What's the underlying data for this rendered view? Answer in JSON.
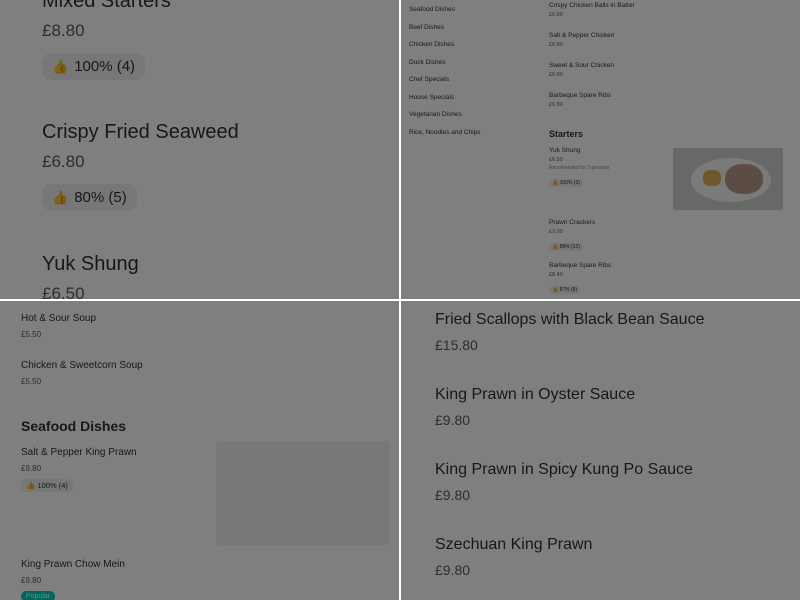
{
  "top_left": {
    "items": [
      {
        "name": "Mixed Starters",
        "price": "£8.80",
        "rating": "100% (4)"
      },
      {
        "name": "Crispy Fried Seaweed",
        "price": "£6.80",
        "rating": "80% (5)"
      },
      {
        "name": "Yuk Shung",
        "price": "£6.50"
      }
    ]
  },
  "top_right": {
    "nav": [
      "Seafood Dishes",
      "Beef Dishes",
      "Chicken Dishes",
      "Duck Dishes",
      "Chef Specials",
      "House Specials",
      "Vegetarian Dishes",
      "Rice, Noodles and Chips"
    ],
    "top_items": [
      {
        "name": "Crispy Chicken Balls in Batter",
        "price": "£6.80"
      },
      {
        "name": "Salt & Pepper Chicken",
        "price": "£6.80"
      },
      {
        "name": "Sweet & Sour Chicken",
        "price": "£6.80"
      },
      {
        "name": "Barbeque Spare Ribs",
        "price": "£6.80"
      }
    ],
    "starters_heading": "Starters",
    "starters": [
      {
        "name": "Yuk Shung",
        "price": "£6.50",
        "desc": "Recomended for 2 persons",
        "rating": "100% (3)"
      },
      {
        "name": "Prawn Crackers",
        "price": "£3.00",
        "rating": "88% (12)"
      },
      {
        "name": "Barbeque Spare Ribs",
        "price": "£8.40",
        "rating": "87% (8)"
      }
    ]
  },
  "bottom_left": {
    "soups": [
      {
        "name": "Hot & Sour Soup",
        "price": "£5.50"
      },
      {
        "name": "Chicken & Sweetcorn Soup",
        "price": "£5.50"
      }
    ],
    "seafood_heading": "Seafood Dishes",
    "seafood": [
      {
        "name": "Salt & Pepper King Prawn",
        "price": "£9.80",
        "rating": "100% (4)"
      },
      {
        "name": "King Prawn Chow Mein",
        "price": "£9.80",
        "badge": "Popular"
      }
    ]
  },
  "bottom_right": {
    "items": [
      {
        "name": "Fried Scallops with Black Bean Sauce",
        "price": "£15.80"
      },
      {
        "name": "King Prawn in Oyster Sauce",
        "price": "£9.80"
      },
      {
        "name": "King Prawn in Spicy Kung Po Sauce",
        "price": "£9.80"
      },
      {
        "name": "Szechuan King Prawn",
        "price": "£9.80"
      }
    ]
  },
  "colors": {
    "accent": "#00ccbc",
    "text": "#2e3333",
    "overlay": "rgba(0,0,0,0.5)"
  },
  "icons": {
    "rating": "thumbs-up-icon"
  }
}
